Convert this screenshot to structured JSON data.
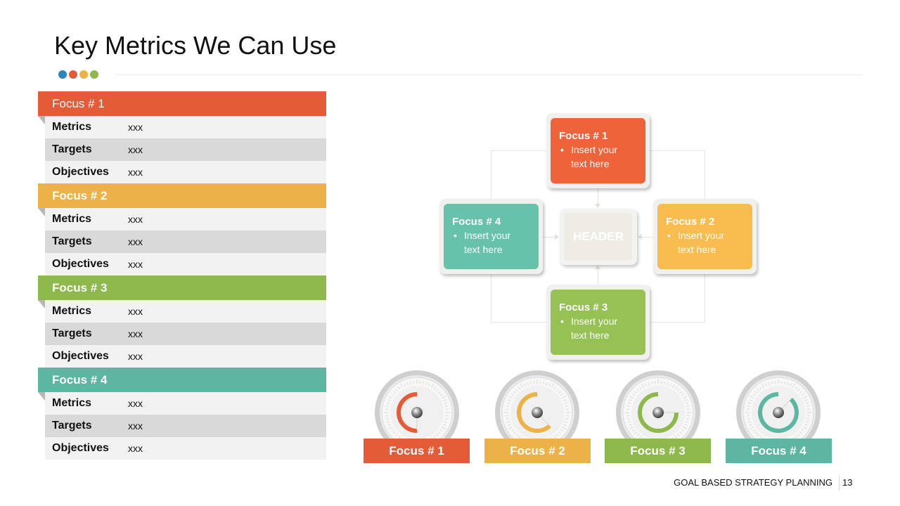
{
  "title": "Key Metrics We Can Use",
  "colors": {
    "dot_blue": "#2e86c1",
    "focus1": "#e35c37",
    "focus2": "#ecb248",
    "focus3": "#8db84b",
    "focus4": "#5db6a1",
    "card1": "#ef633b",
    "card2": "#f8bd4e",
    "card3": "#96c253",
    "card4": "#66c2ab"
  },
  "table": {
    "sections": [
      {
        "name": "Focus # 1",
        "rows": [
          {
            "label": "Metrics",
            "value": "xxx"
          },
          {
            "label": "Targets",
            "value": "xxx"
          },
          {
            "label": "Objectives",
            "value": "xxx"
          }
        ]
      },
      {
        "name": "Focus # 2",
        "rows": [
          {
            "label": "Metrics",
            "value": "xxx"
          },
          {
            "label": "Targets",
            "value": "xxx"
          },
          {
            "label": "Objectives",
            "value": "xxx"
          }
        ]
      },
      {
        "name": "Focus # 3",
        "rows": [
          {
            "label": "Metrics",
            "value": "xxx"
          },
          {
            "label": "Targets",
            "value": "xxx"
          },
          {
            "label": "Objectives",
            "value": "xxx"
          }
        ]
      },
      {
        "name": "Focus # 4",
        "rows": [
          {
            "label": "Metrics",
            "value": "xxx"
          },
          {
            "label": "Targets",
            "value": "xxx"
          },
          {
            "label": "Objectives",
            "value": "xxx"
          }
        ]
      }
    ]
  },
  "diagram": {
    "header": "HEADER",
    "cards": [
      {
        "title": "Focus # 1",
        "bullet": "Insert your text here"
      },
      {
        "title": "Focus # 2",
        "bullet": "Insert your text here"
      },
      {
        "title": "Focus # 3",
        "bullet": "Insert your text here"
      },
      {
        "title": "Focus # 4",
        "bullet": "Insert your text here"
      }
    ],
    "bullet_char": "•"
  },
  "gauges": [
    {
      "label": "Focus # 1",
      "progress_percent": 50
    },
    {
      "label": "Focus # 2",
      "progress_percent": 62
    },
    {
      "label": "Focus # 3",
      "progress_percent": 75
    },
    {
      "label": "Focus # 4",
      "progress_percent": 88
    }
  ],
  "footer": {
    "text": "GOAL BASED STRATEGY PLANNING",
    "page_number": "13"
  }
}
